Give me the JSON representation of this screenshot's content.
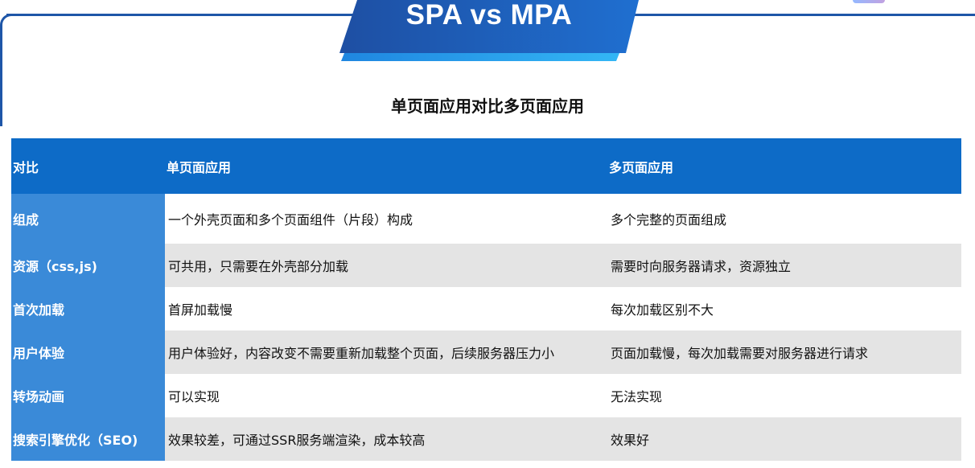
{
  "slide": {
    "title": "SPA vs MPA",
    "subtitle": "单页面应用对比多页面应用"
  },
  "colors": {
    "banner_dark": "#1e4fa3",
    "banner_light": "#2aa3ee",
    "header_bg": "#0d6bc7",
    "first_col_bg": "#3a8ad8",
    "row_alt_bg": "#e4e4e4"
  },
  "table": {
    "headers": [
      "对比",
      "单页面应用",
      "多页面应用"
    ],
    "rows": [
      {
        "label": "组成",
        "spa": "一个外壳页面和多个页面组件（片段）构成",
        "mpa": "多个完整的页面组成"
      },
      {
        "label": "资源（css,js)",
        "spa": "可共用，只需要在外壳部分加载",
        "mpa": "需要时向服务器请求，资源独立"
      },
      {
        "label": "首次加载",
        "spa": "首屏加载慢",
        "mpa": "每次加载区别不大"
      },
      {
        "label": "用户体验",
        "spa": "用户体验好，内容改变不需要重新加载整个页面，后续服务器压力小",
        "mpa": "页面加载慢，每次加载需要对服务器进行请求"
      },
      {
        "label": "转场动画",
        "spa": "可以实现",
        "mpa": "无法实现"
      },
      {
        "label": "搜索引擎优化（SEO)",
        "spa": "效果较差，可通过SSR服务端渲染，成本较高",
        "mpa": "效果好"
      }
    ]
  }
}
